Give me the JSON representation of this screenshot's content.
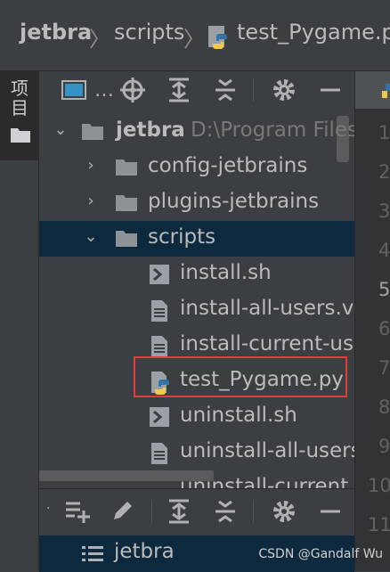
{
  "breadcrumb": {
    "items": [
      "jetbra",
      "scripts",
      "test_Pygame.py"
    ],
    "separator": "〉"
  },
  "tool_stripe": {
    "project_tab_label": "项目"
  },
  "project_panel": {
    "toolbar_icons": [
      "view-mode-icon",
      "more-dots-icon",
      "locate-icon",
      "expand-all-icon",
      "collapse-all-icon",
      "gear-icon",
      "minimize-icon"
    ],
    "more_label": "…",
    "tree": [
      {
        "label": "jetbra",
        "hint": "D:\\Program Files",
        "type": "folder",
        "expanded": true
      },
      {
        "label": "config-jetbrains",
        "type": "folder",
        "expanded": false
      },
      {
        "label": "plugins-jetbrains",
        "type": "folder",
        "expanded": false
      },
      {
        "label": "scripts",
        "type": "folder",
        "expanded": true,
        "selected": true
      },
      {
        "label": "install.sh",
        "type": "shell"
      },
      {
        "label": "install-all-users.vb",
        "type": "text"
      },
      {
        "label": "install-current-us",
        "type": "text"
      },
      {
        "label": "test_Pygame.py",
        "type": "python",
        "highlighted": true
      },
      {
        "label": "uninstall.sh",
        "type": "shell"
      },
      {
        "label": "uninstall-all-users",
        "type": "text"
      },
      {
        "label": "uninstall-current",
        "type": "text"
      }
    ]
  },
  "bottom_panel": {
    "row_label": "jetbra"
  },
  "gutter": {
    "line_numbers": [
      "1",
      "2",
      "3",
      "4",
      "5",
      "6",
      "7",
      "8",
      "9",
      "10",
      "11"
    ],
    "current_line": "5"
  },
  "watermark": "CSDN @Gandalf Wu",
  "colors": {
    "background": "#3c3f41",
    "selection": "#0d293e",
    "highlight_border": "#e03c3c",
    "folder": "#8d9296",
    "python_blue": "#3572a5",
    "python_yellow": "#f2c94c"
  }
}
